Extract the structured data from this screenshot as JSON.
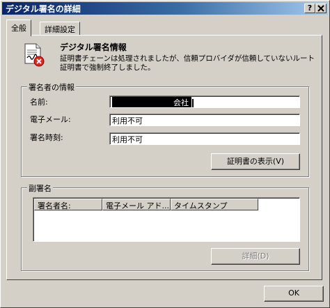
{
  "window": {
    "title": "デジタル署名の詳細",
    "help_button": "?",
    "close_button": "X"
  },
  "tabs": [
    {
      "label": "全般",
      "active": true
    },
    {
      "label": "詳細設定",
      "active": false
    }
  ],
  "signature_info": {
    "icon": "signature-warning-icon",
    "heading": "デジタル署名情報",
    "message_line1": "証明書チェーンは処理されましたが、信頼プロバイダが信頼していないルート",
    "message_line2": "証明書で強制終了しました。"
  },
  "signer": {
    "group_label": "署名者の情報",
    "name_label": "名前:",
    "name_value": "会社",
    "email_label": "電子メール:",
    "email_value": "利用不可",
    "time_label": "署名時刻:",
    "time_value": "利用不可",
    "view_cert_button": "証明書の表示(V)"
  },
  "countersignatures": {
    "group_label": "副署名",
    "columns": [
      "署名者名:",
      "電子メール アド...",
      "タイムスタンプ"
    ],
    "rows": [],
    "details_button": "詳細(D)"
  },
  "footer": {
    "ok_button": "OK"
  },
  "colors": {
    "title_gradient_start": "#0a246a",
    "title_gradient_end": "#a6caf0",
    "face": "#d4d0c8",
    "error_red": "#e32222"
  }
}
